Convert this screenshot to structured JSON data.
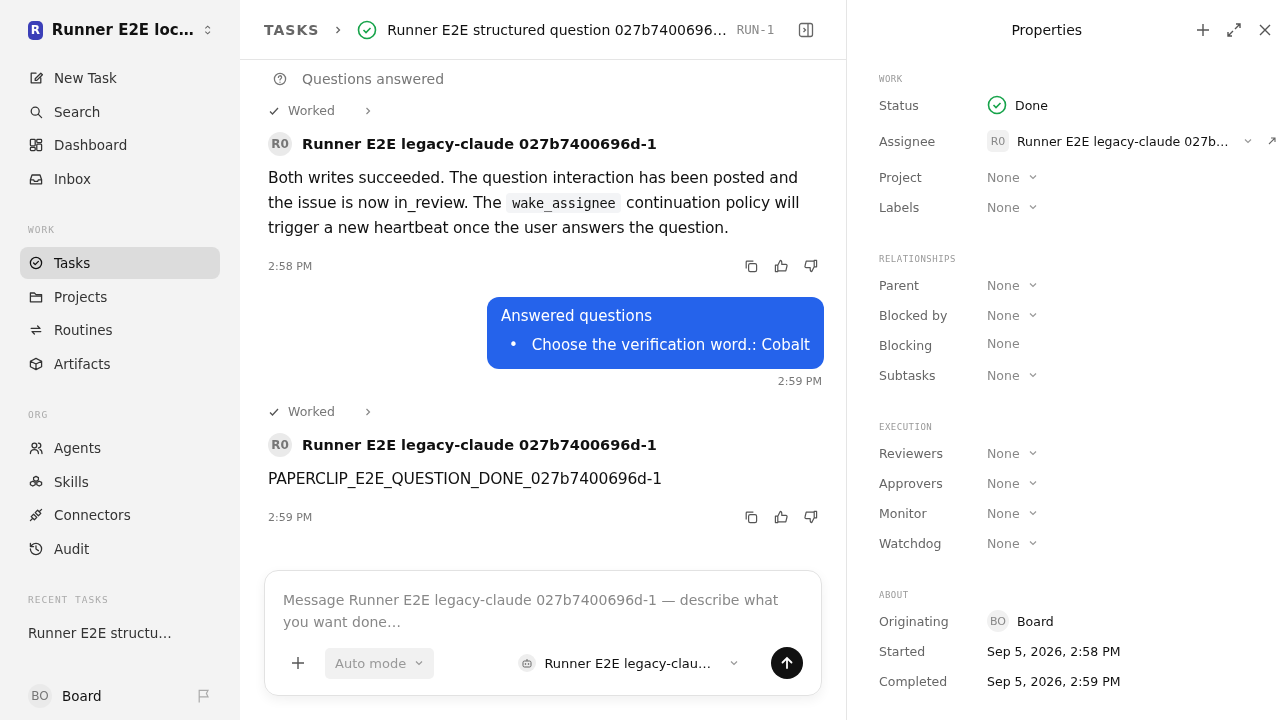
{
  "sidebar": {
    "workspace": {
      "logo": "R",
      "name": "Runner E2E loc…"
    },
    "nav": [
      {
        "label": "New Task",
        "selected": false
      },
      {
        "label": "Search",
        "selected": false
      },
      {
        "label": "Dashboard",
        "selected": false
      },
      {
        "label": "Inbox",
        "selected": false
      }
    ],
    "sections": [
      {
        "title": "WORK",
        "items": [
          {
            "label": "Tasks",
            "selected": true
          },
          {
            "label": "Projects",
            "selected": false
          },
          {
            "label": "Routines",
            "selected": false
          },
          {
            "label": "Artifacts",
            "selected": false
          }
        ]
      },
      {
        "title": "ORG",
        "items": [
          {
            "label": "Agents",
            "selected": false
          },
          {
            "label": "Skills",
            "selected": false
          },
          {
            "label": "Connectors",
            "selected": false
          },
          {
            "label": "Audit",
            "selected": false
          }
        ]
      }
    ],
    "recent": {
      "title": "RECENT TASKS",
      "items": [
        {
          "label": "Runner E2E structu…",
          "selected": false
        }
      ]
    },
    "user": {
      "initials": "BO",
      "name": "Board"
    }
  },
  "header": {
    "section": "TASKS",
    "title": "Runner E2E structured question 027b7400696…",
    "id": "RUN-1"
  },
  "feed": [
    {
      "kind": "event",
      "text": "Questions answered"
    },
    {
      "kind": "worked",
      "text": "Worked"
    },
    {
      "kind": "agent",
      "initials": "R0",
      "author": "Runner E2E legacy-claude 027b7400696d-1",
      "parts": [
        {
          "kind": "text",
          "text": "Both writes succeeded. The question interaction has been posted and the issue is now in_review. The "
        },
        {
          "kind": "code",
          "text": "wake_assignee"
        },
        {
          "kind": "text",
          "text": " continuation policy will trigger a new heartbeat once the user answers the question."
        }
      ],
      "time": "2:58 PM"
    },
    {
      "kind": "user",
      "title": "Answered questions",
      "bullets": [
        {
          "marker": "•",
          "text": "Choose the verification word.: Cobalt"
        }
      ],
      "time": "2:59 PM"
    },
    {
      "kind": "worked",
      "text": "Worked"
    },
    {
      "kind": "agent",
      "initials": "R0",
      "author": "Runner E2E legacy-claude 027b7400696d-1",
      "parts": [
        {
          "kind": "text",
          "text": "PAPERCLIP_E2E_QUESTION_DONE_027b7400696d-1"
        }
      ],
      "time": "2:59 PM"
    }
  ],
  "composer": {
    "placeholder": "Message Runner E2E legacy-claude 027b7400696d-1 — describe what you want done…",
    "mode": "Auto mode",
    "agent": "Runner E2E legacy-clau…"
  },
  "properties": {
    "title": "Properties",
    "sections": [
      {
        "title": "WORK",
        "rows": [
          {
            "kind": "status",
            "label": "Status",
            "value": "Done"
          },
          {
            "kind": "person",
            "label": "Assignee",
            "initials": "R0",
            "value": "Runner E2E legacy-claude 027b…"
          },
          {
            "kind": "select",
            "label": "Project",
            "value": "None"
          },
          {
            "kind": "select",
            "label": "Labels",
            "value": "None"
          }
        ]
      },
      {
        "title": "RELATIONSHIPS",
        "rows": [
          {
            "kind": "select",
            "label": "Parent",
            "value": "None"
          },
          {
            "kind": "select",
            "label": "Blocked by",
            "value": "None"
          },
          {
            "kind": "plain",
            "label": "Blocking",
            "value": "None"
          },
          {
            "kind": "select",
            "label": "Subtasks",
            "value": "None"
          }
        ]
      },
      {
        "title": "EXECUTION",
        "rows": [
          {
            "kind": "select",
            "label": "Reviewers",
            "value": "None"
          },
          {
            "kind": "select",
            "label": "Approvers",
            "value": "None"
          },
          {
            "kind": "select",
            "label": "Monitor",
            "value": "None"
          },
          {
            "kind": "select",
            "label": "Watchdog",
            "value": "None"
          }
        ]
      },
      {
        "title": "ABOUT",
        "rows": [
          {
            "kind": "origin",
            "label": "Originating",
            "initials": "BO",
            "value": "Board"
          },
          {
            "kind": "date",
            "label": "Started",
            "value": "Sep 5, 2026, 2:58 PM"
          },
          {
            "kind": "date",
            "label": "Completed",
            "value": "Sep 5, 2026, 2:59 PM"
          }
        ]
      }
    ]
  }
}
